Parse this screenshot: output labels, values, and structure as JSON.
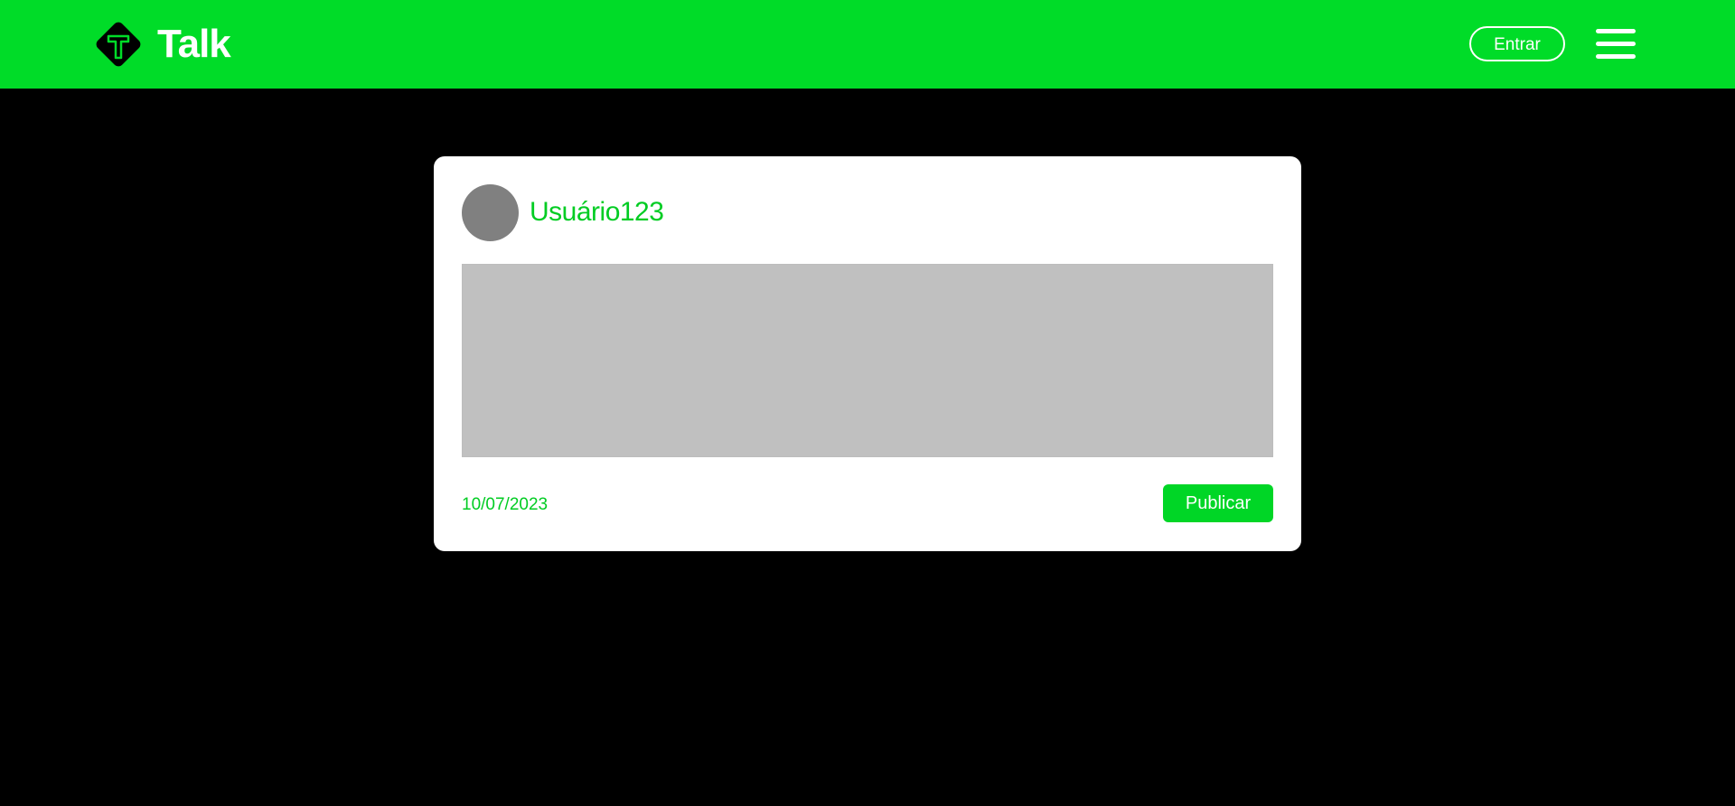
{
  "header": {
    "brand": "Talk",
    "logo_letter": "T",
    "login_label": "Entrar",
    "menu_icon": "hamburger-icon",
    "logo_icon": "diamond-t-logo-icon"
  },
  "post": {
    "username": "Usuário123",
    "text_value": "",
    "date": "10/07/2023",
    "publish_label": "Publicar"
  },
  "colors": {
    "brand_green": "#00dc28",
    "text_green": "#00cc22",
    "background": "#000000",
    "card": "#ffffff",
    "avatar": "#808080",
    "textarea": "#c0c0c0"
  }
}
